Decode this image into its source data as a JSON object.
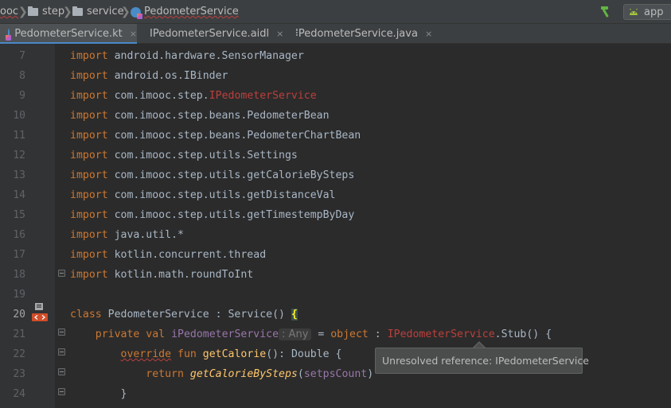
{
  "breadcrumb": {
    "items": [
      {
        "label": "ooc"
      },
      {
        "label": "step"
      },
      {
        "label": "service"
      },
      {
        "label": "PedometerService"
      }
    ],
    "separator": "❯"
  },
  "toolbar": {
    "run_config": "app",
    "build_icon": "hammer-icon"
  },
  "tabs": [
    {
      "label": "PedometerService.kt",
      "icon": "kotlin-file-icon",
      "active": true
    },
    {
      "label": "IPedometerService.aidl",
      "icon": "android-icon",
      "active": false
    },
    {
      "label": "IPedometerService.java",
      "icon": "java-file-icon",
      "active": false
    }
  ],
  "tab_close_glyph": "×",
  "editor": {
    "current_line": 20,
    "lines": [
      {
        "n": "7",
        "tokens": [
          {
            "t": "import",
            "c": "kw"
          },
          {
            "t": " android.hardware.SensorManager"
          }
        ]
      },
      {
        "n": "8",
        "tokens": [
          {
            "t": "import",
            "c": "kw"
          },
          {
            "t": " android.os.IBinder"
          }
        ]
      },
      {
        "n": "9",
        "tokens": [
          {
            "t": "import",
            "c": "kw"
          },
          {
            "t": " com.imooc.step."
          },
          {
            "t": "IPedometerService",
            "c": "err"
          }
        ]
      },
      {
        "n": "10",
        "tokens": [
          {
            "t": "import",
            "c": "kw"
          },
          {
            "t": " com.imooc.step.beans.PedometerBean"
          }
        ]
      },
      {
        "n": "11",
        "tokens": [
          {
            "t": "import",
            "c": "kw"
          },
          {
            "t": " com.imooc.step.beans.PedometerChartBean"
          }
        ]
      },
      {
        "n": "12",
        "tokens": [
          {
            "t": "import",
            "c": "kw"
          },
          {
            "t": " com.imooc.step.utils.Settings"
          }
        ]
      },
      {
        "n": "13",
        "tokens": [
          {
            "t": "import",
            "c": "kw"
          },
          {
            "t": " com.imooc.step.utils.getCalorieBySteps"
          }
        ]
      },
      {
        "n": "14",
        "tokens": [
          {
            "t": "import",
            "c": "kw"
          },
          {
            "t": " com.imooc.step.utils.getDistanceVal"
          }
        ]
      },
      {
        "n": "15",
        "tokens": [
          {
            "t": "import",
            "c": "kw"
          },
          {
            "t": " com.imooc.step.utils.getTimestempByDay"
          }
        ]
      },
      {
        "n": "16",
        "tokens": [
          {
            "t": "import",
            "c": "kw"
          },
          {
            "t": " java.util.*"
          }
        ]
      },
      {
        "n": "17",
        "tokens": [
          {
            "t": "import",
            "c": "kw"
          },
          {
            "t": " kotlin.concurrent.thread"
          }
        ]
      },
      {
        "n": "18",
        "tokens": [
          {
            "t": "import",
            "c": "kw"
          },
          {
            "t": " kotlin.math.roundToInt"
          }
        ]
      },
      {
        "n": "19",
        "tokens": []
      },
      {
        "n": "20",
        "tokens": [
          {
            "t": "class",
            "c": "kw"
          },
          {
            "t": " PedometerService : Service() "
          },
          {
            "t": "{",
            "c": "brace-hl"
          }
        ]
      },
      {
        "n": "21",
        "tokens": [
          {
            "t": "    "
          },
          {
            "t": "private val",
            "c": "kw"
          },
          {
            "t": " "
          },
          {
            "t": "iPedometerService",
            "c": "pv"
          },
          {
            "t": ": Any",
            "c": "hint"
          },
          {
            "t": " = "
          },
          {
            "t": "object",
            "c": "kw"
          },
          {
            "t": " : "
          },
          {
            "t": "IPedometerService",
            "c": "err"
          },
          {
            "t": ".Stub() {"
          }
        ]
      },
      {
        "n": "22",
        "tokens": [
          {
            "t": "        "
          },
          {
            "t": "override",
            "c": "kw squiggle"
          },
          {
            "t": " "
          },
          {
            "t": "fun",
            "c": "kw"
          },
          {
            "t": " "
          },
          {
            "t": "getCalorie",
            "c": "fn"
          },
          {
            "t": "(): Double {"
          }
        ]
      },
      {
        "n": "23",
        "tokens": [
          {
            "t": "            "
          },
          {
            "t": "return",
            "c": "kw"
          },
          {
            "t": " "
          },
          {
            "t": "getCalorieBySteps",
            "c": "fni"
          },
          {
            "t": "("
          },
          {
            "t": "setpsCount",
            "c": "pv"
          },
          {
            "t": ")"
          }
        ]
      },
      {
        "n": "24",
        "tokens": [
          {
            "t": "        }"
          }
        ]
      }
    ]
  },
  "tooltip": {
    "text": "Unresolved reference: IPedometerService"
  },
  "colors": {
    "keyword": "#cc7832",
    "error": "#bc3f3c",
    "function": "#ffc66d",
    "property": "#9876aa",
    "text": "#a9b7c6"
  }
}
